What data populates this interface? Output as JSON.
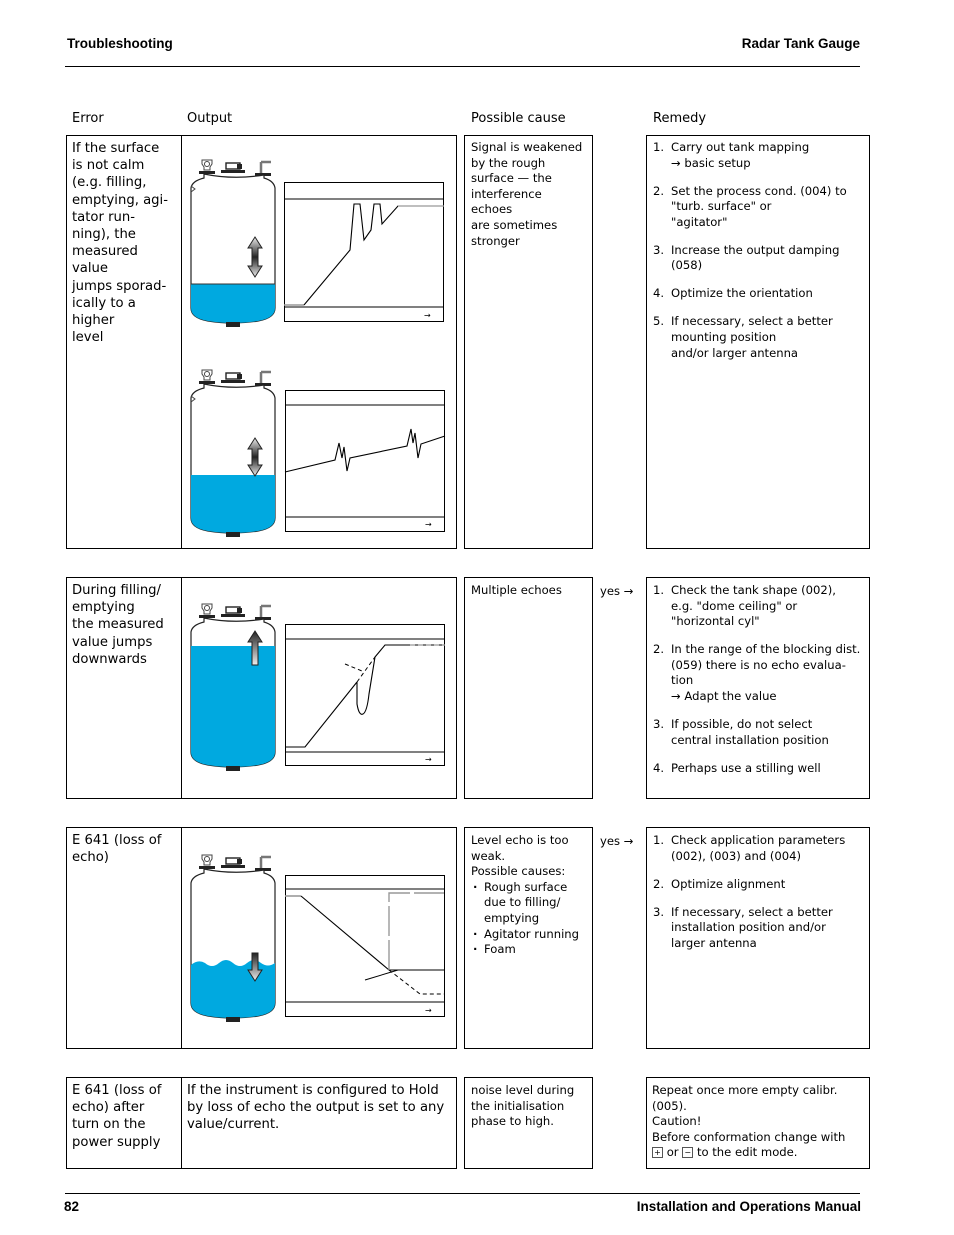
{
  "header": {
    "left": "Troubleshooting",
    "right": "Radar Tank Gauge"
  },
  "footer": {
    "page_number": "82",
    "right": "Installation and Operations Manual"
  },
  "columns": {
    "error": "Error",
    "output": "Output",
    "cause": "Possible cause",
    "remedy": "Remedy"
  },
  "colors": {
    "liquid": "#00A9E0",
    "line": "#000000"
  },
  "rows": [
    {
      "error": "If the surface is not calm (e.g. filling, emptying, agi-tator run-ning), the measured value jumps sporad-ically to a higher level",
      "error_lines": [
        "If the surface",
        "is not calm",
        "(e.g. filling,",
        "emptying, agi-",
        "tator run-",
        "ning), the",
        "measured",
        "value",
        "jumps sporad-",
        "ically to a",
        "higher",
        "level"
      ],
      "figures": [
        "tank-with-bidirectional-arrow",
        "echo-curve-spikes-up",
        "tank-with-bidirectional-arrow",
        "zigzag-echo-curve"
      ],
      "cause_lines": [
        "Signal is weakened",
        "by the rough",
        "surface — the",
        "interference",
        "echoes",
        "are sometimes",
        "stronger"
      ],
      "yes": "",
      "remedy": [
        {
          "num": "1.",
          "lines": [
            "Carry out tank mapping",
            "→ basic setup"
          ]
        },
        {
          "num": "2.",
          "lines": [
            "Set the process cond. (004) to",
            "\"turb. surface\" or",
            "\"agitator\""
          ]
        },
        {
          "num": "3.",
          "lines": [
            "Increase the output damping",
            "(058)"
          ]
        },
        {
          "num": "4.",
          "lines": [
            "Optimize the orientation"
          ]
        },
        {
          "num": "5.",
          "lines": [
            "If necessary, select a better",
            "mounting position",
            "and/or larger antenna"
          ]
        }
      ]
    },
    {
      "error_lines": [
        "During filling/",
        "emptying",
        "the measured",
        "value jumps",
        "downwards"
      ],
      "figures": [
        "tank-full-with-up-arrow",
        "echo-curve-dip-down"
      ],
      "cause_lines": [
        "Multiple echoes"
      ],
      "yes": "yes →",
      "remedy": [
        {
          "num": "1.",
          "lines": [
            "Check the tank shape (002),",
            "e.g. \"dome ceiling\" or",
            "\"horizontal cyl\""
          ]
        },
        {
          "num": "2.",
          "lines": [
            "In the range of the blocking dist.",
            "(059) there is no echo evalua-",
            "tion",
            "→ Adapt the value"
          ]
        },
        {
          "num": "3.",
          "lines": [
            "If possible, do not select",
            "central installation position"
          ]
        },
        {
          "num": "4.",
          "lines": [
            "Perhaps use a stilling well"
          ]
        }
      ]
    },
    {
      "error_lines": [
        "E 641 (loss of",
        "echo)"
      ],
      "figures": [
        "tank-wavy-with-down-arrow",
        "echo-curve-loss"
      ],
      "cause_intro": [
        "Level echo is too",
        "weak.",
        "Possible causes:"
      ],
      "cause_bullets": [
        [
          "Rough surface",
          "due to filling/",
          "emptying"
        ],
        [
          "Agitator running"
        ],
        [
          "Foam"
        ]
      ],
      "yes": "yes →",
      "remedy": [
        {
          "num": "1.",
          "lines": [
            "Check application parameters",
            "(002), (003) and (004)"
          ]
        },
        {
          "num": "2.",
          "lines": [
            "Optimize alignment"
          ]
        },
        {
          "num": "3.",
          "lines": [
            "If necessary, select a better",
            "installation position and/or",
            "larger antenna"
          ]
        }
      ]
    },
    {
      "error_lines": [
        "E 641 (loss of",
        "echo) after",
        "turn on the",
        "power supply"
      ],
      "output_lines": [
        "If the instrument is configured to Hold",
        "by loss of echo the output is set to any",
        "value/current."
      ],
      "cause_lines": [
        "noise level during",
        "the initialisation",
        "phase to high."
      ],
      "yes": "",
      "remedy_lines": [
        "Repeat once more empty calibr.",
        "(005).",
        "Caution!",
        "Before conformation change with"
      ],
      "remedy_last": {
        "key_plus": "+",
        "or": "or",
        "key_minus": "−",
        "tail": "to the edit mode."
      }
    }
  ],
  "chart_axis_arrow": "→"
}
